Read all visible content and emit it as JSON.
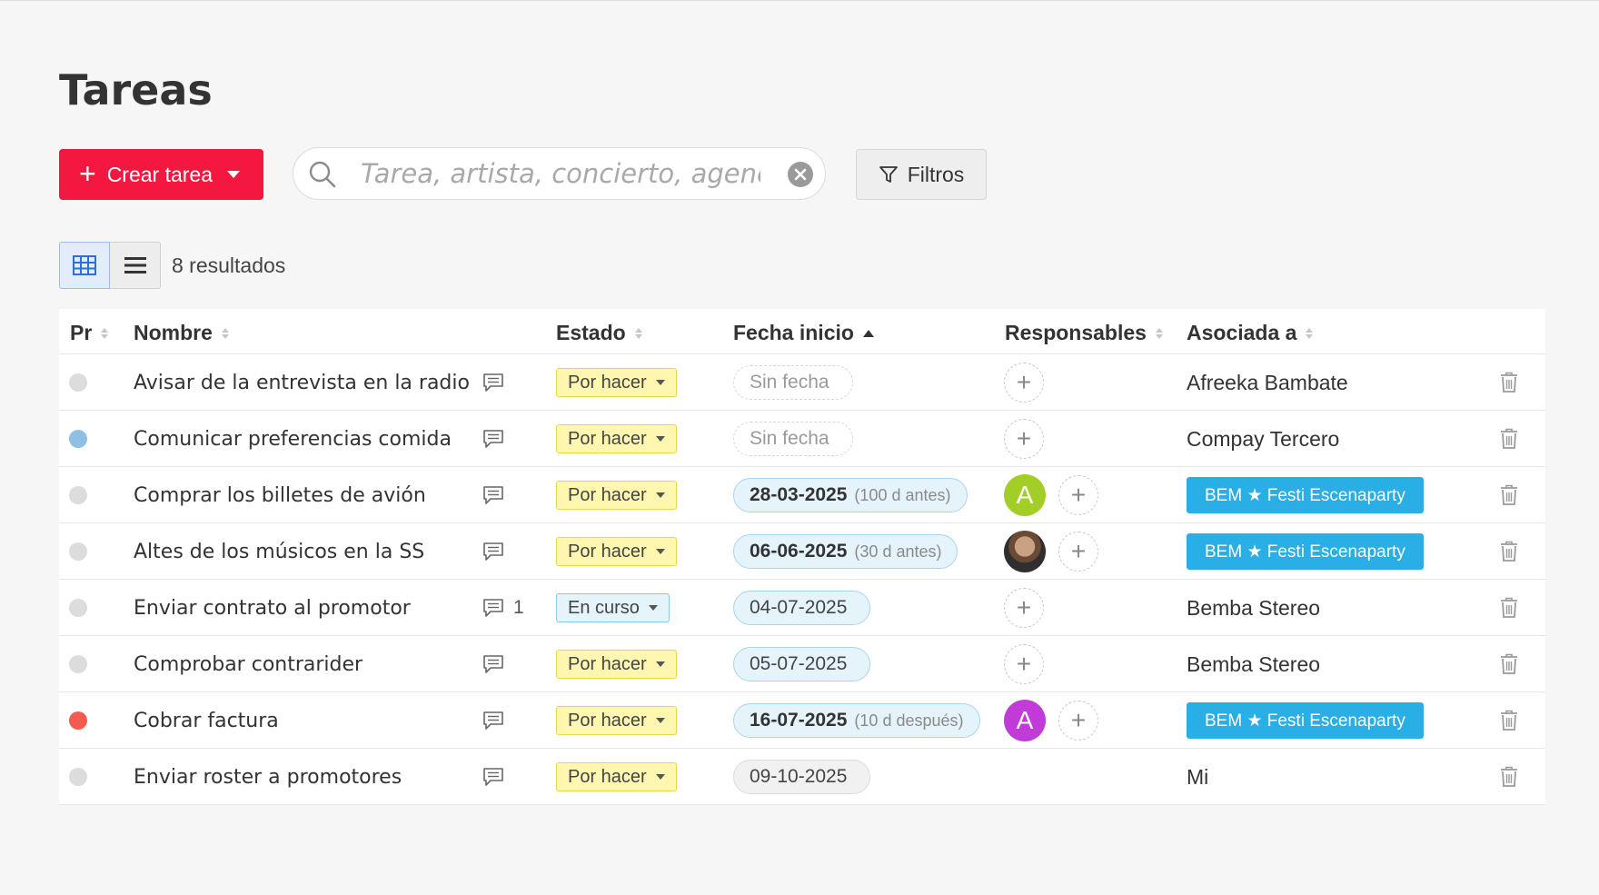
{
  "page": {
    "title": "Tareas"
  },
  "toolbar": {
    "create_label": "Crear tarea",
    "search_placeholder": "Tarea, artista, concierto, agencia",
    "search_value": "",
    "filters_label": "Filtros",
    "results": "8 resultados"
  },
  "icons": {
    "search": "search-icon",
    "clear": "clear-icon",
    "filter": "filter-icon",
    "grid": "grid-icon",
    "list": "list-icon",
    "comment": "comment-icon",
    "trash": "trash-icon"
  },
  "colors": {
    "accent": "#f4173f",
    "tag": "#2aaee6",
    "avatar_green": "#a3ce27",
    "avatar_purple": "#c03bd8",
    "prio_blue": "#8ec0e6",
    "prio_red": "#f45a4f",
    "prio_none": "#dcdcdc"
  },
  "table": {
    "headers": {
      "priority": "Pr",
      "name": "Nombre",
      "status": "Estado",
      "start_date": "Fecha inicio",
      "assignees": "Responsables",
      "associated": "Asociada a"
    },
    "rows": [
      {
        "priority": "none",
        "name": "Avisar de la entrevista en la radio",
        "comments": "",
        "status": "Por hacer",
        "date": "Sin fecha",
        "date_rel": "",
        "date_style": "empty",
        "avatar": "",
        "associated": "Afreeka Bambate",
        "associated_tag": false
      },
      {
        "priority": "blue",
        "name": "Comunicar preferencias comida",
        "comments": "",
        "status": "Por hacer",
        "date": "Sin fecha",
        "date_rel": "",
        "date_style": "empty",
        "avatar": "",
        "associated": "Compay Tercero",
        "associated_tag": false
      },
      {
        "priority": "none",
        "name": "Comprar los billetes de avión",
        "comments": "",
        "status": "Por hacer",
        "date": "28-03-2025",
        "date_rel": "(100 d antes)",
        "date_style": "blue",
        "avatar": "A-green",
        "associated": "BEM ★ Festi Escenaparty",
        "associated_tag": true
      },
      {
        "priority": "none",
        "name": "Altes de los músicos en la SS",
        "comments": "",
        "status": "Por hacer",
        "date": "06-06-2025",
        "date_rel": "(30 d antes)",
        "date_style": "blue",
        "avatar": "photo",
        "associated": "BEM ★ Festi Escenaparty",
        "associated_tag": true
      },
      {
        "priority": "none",
        "name": "Enviar contrato al promotor",
        "comments": "1",
        "status": "En curso",
        "date": "04-07-2025",
        "date_rel": "",
        "date_style": "blue-plain",
        "avatar": "",
        "associated": "Bemba Stereo",
        "associated_tag": false
      },
      {
        "priority": "none",
        "name": "Comprobar contrarider",
        "comments": "",
        "status": "Por hacer",
        "date": "05-07-2025",
        "date_rel": "",
        "date_style": "blue-plain",
        "avatar": "",
        "associated": "Bemba Stereo",
        "associated_tag": false
      },
      {
        "priority": "red",
        "name": "Cobrar factura",
        "comments": "",
        "status": "Por hacer",
        "date": "16-07-2025",
        "date_rel": "(10 d después)",
        "date_style": "blue",
        "avatar": "A-purple",
        "associated": "BEM ★ Festi Escenaparty",
        "associated_tag": true
      },
      {
        "priority": "none",
        "name": "Enviar roster a promotores",
        "comments": "",
        "status": "Por hacer",
        "date": "09-10-2025",
        "date_rel": "",
        "date_style": "gray",
        "avatar": "none",
        "associated": "Mi",
        "associated_tag": false
      }
    ],
    "avatar_letter": "A"
  }
}
